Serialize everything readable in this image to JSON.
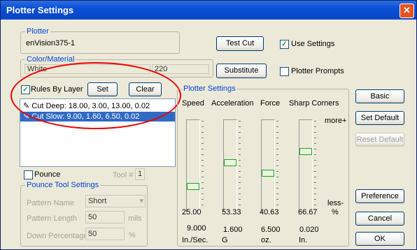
{
  "window": {
    "title": "Plotter Settings",
    "close": "✕"
  },
  "plotter": {
    "group_label": "Plotter",
    "name": "enVision375-1",
    "test_cut": "Test Cut",
    "use_settings": "Use Settings",
    "use_settings_checked": true
  },
  "color_material": {
    "group_label": "Color/Material",
    "color": "White",
    "value": "220",
    "substitute": "Substitute",
    "plotter_prompts": "Plotter Prompts"
  },
  "layers": {
    "rules_by_layer": "Rules By Layer",
    "set": "Set",
    "clear": "Clear",
    "items": [
      {
        "text": "Cut Deep:  18.00,  3.00, 13.00,  0.02"
      },
      {
        "text": "Cut Slow:  9.00,  1.60,  6.50,  0.02"
      }
    ]
  },
  "pounce": {
    "label": "Pounce",
    "tool_label": "Tool #",
    "tool_value": "1",
    "group_label": "Pounce Tool Settings",
    "pattern_name_label": "Pattern Name",
    "pattern_name_value": "Short",
    "pattern_length_label": "Pattern Length",
    "pattern_length_value": "50",
    "pattern_length_unit": "mils",
    "down_percentage_label": "Down Percentage",
    "down_percentage_value": "50",
    "down_percentage_unit": "%"
  },
  "plotter_settings": {
    "group_label": "Plotter Settings",
    "more": "more+",
    "less": "less-",
    "percent": "%",
    "columns": [
      {
        "header": "Speed",
        "pct": "25.00",
        "value": "9.000",
        "unit": "In./Sec.",
        "level": 0.25
      },
      {
        "header": "Acceleration",
        "pct": "53.33",
        "value": "1.600",
        "unit": "G",
        "level": 0.5333
      },
      {
        "header": "Force",
        "pct": "40.63",
        "value": "6.500",
        "unit": "oz.",
        "level": 0.4063
      },
      {
        "header": "Sharp Corners",
        "pct": "66.67",
        "value": "0.020",
        "unit": "In.",
        "level": 0.6667
      }
    ]
  },
  "buttons": {
    "basic": "Basic",
    "set_default": "Set Default",
    "reset_default": "Reset Default",
    "preference": "Preference",
    "cancel": "Cancel",
    "ok": "OK"
  }
}
